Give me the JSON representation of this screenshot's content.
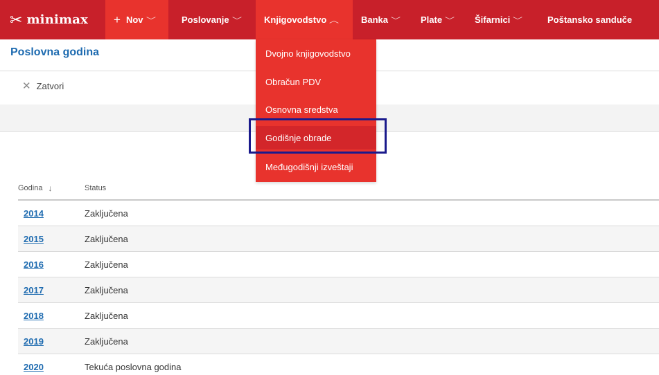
{
  "app": {
    "logo_text": "minimax",
    "logo_icon": "scissors-x-icon"
  },
  "nav": {
    "new_label": "Nov",
    "items": [
      {
        "label": "Poslovanje"
      },
      {
        "label": "Knjigovodstvo"
      },
      {
        "label": "Banka"
      },
      {
        "label": "Plate"
      },
      {
        "label": "Šifarnici"
      },
      {
        "label": "Poštansko sanduče"
      }
    ]
  },
  "colors": {
    "nav_bg": "#c8202a",
    "nav_active": "#e8332d",
    "link": "#1e6bb0",
    "highlight": "#1a1a8c"
  },
  "dropdown": {
    "items": [
      {
        "label": "Dvojno knjigovodstvo"
      },
      {
        "label": "Obračun PDV"
      },
      {
        "label": "Osnovna sredstva"
      },
      {
        "label": "Godišnje obrade"
      },
      {
        "label": "Međugodišnji izveštaji"
      }
    ]
  },
  "page": {
    "title": "Poslovna godina",
    "close_label": "Zatvori"
  },
  "table": {
    "columns": {
      "year": "Godina",
      "status": "Status"
    },
    "rows": [
      {
        "year": "2014",
        "status": "Zaključena"
      },
      {
        "year": "2015",
        "status": "Zaključena"
      },
      {
        "year": "2016",
        "status": "Zaključena"
      },
      {
        "year": "2017",
        "status": "Zaključena"
      },
      {
        "year": "2018",
        "status": "Zaključena"
      },
      {
        "year": "2019",
        "status": "Zaključena"
      },
      {
        "year": "2020",
        "status": "Tekuća poslovna godina"
      }
    ]
  }
}
